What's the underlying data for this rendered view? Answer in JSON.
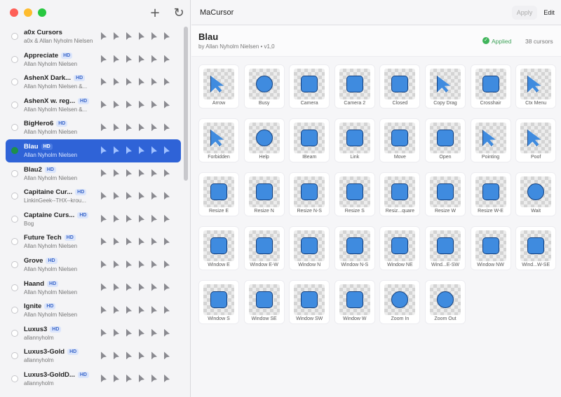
{
  "app": {
    "name": "MaCursor",
    "apply": "Apply",
    "edit": "Edit"
  },
  "sidebar": {
    "add_icon": "+",
    "refresh_icon": "↻",
    "items": [
      {
        "name": "a0x Cursors",
        "author": "a0x & Allan Nyholm Nielsen",
        "hd": "",
        "selected": false
      },
      {
        "name": "Appreciate",
        "author": "Allan Nyholm Nielsen",
        "hd": "HD",
        "selected": false
      },
      {
        "name": "AshenX Dark...",
        "author": "Allan Nyholm Nielsen &...",
        "hd": "HD",
        "selected": false
      },
      {
        "name": "AshenX w. reg...",
        "author": "Allan Nyholm Nielsen &...",
        "hd": "HD",
        "selected": false
      },
      {
        "name": "BigHero6",
        "author": "Allan Nyholm Nielsen",
        "hd": "HD",
        "selected": false
      },
      {
        "name": "Blau",
        "author": "Allan Nyholm Nielsen",
        "hd": "HD",
        "selected": true
      },
      {
        "name": "Blau2",
        "author": "Allan Nyholm Nielsen",
        "hd": "HD",
        "selected": false
      },
      {
        "name": "Capitaine Cur...",
        "author": "LinkinGeek--THX--krou...",
        "hd": "HD",
        "selected": false
      },
      {
        "name": "Captaine Curs...",
        "author": "Bog",
        "hd": "HD",
        "selected": false
      },
      {
        "name": "Future Tech",
        "author": "Allan Nyholm Nielsen",
        "hd": "HD",
        "selected": false
      },
      {
        "name": "Grove",
        "author": "Allan Nyholm Nielsen",
        "hd": "HD",
        "selected": false
      },
      {
        "name": "Haand",
        "author": "Allan Nyholm Nielsen",
        "hd": "HD",
        "selected": false
      },
      {
        "name": "Ignite",
        "author": "Allan Nyholm Nielsen",
        "hd": "HD",
        "selected": false
      },
      {
        "name": "Luxus3",
        "author": "allannyholm",
        "hd": "HD",
        "selected": false
      },
      {
        "name": "Luxus3-Gold",
        "author": "allannyholm",
        "hd": "HD",
        "selected": false
      },
      {
        "name": "Luxus3-GoldD...",
        "author": "allannyholm",
        "hd": "HD",
        "selected": false
      }
    ]
  },
  "theme": {
    "title": "Blau",
    "subtitle": "by Allan Nyholm Nielsen • v1,0",
    "status": "Applied",
    "count": "38 cursors"
  },
  "cursors": [
    {
      "label": "Arrow",
      "shape": "arrow"
    },
    {
      "label": "Busy",
      "shape": "round"
    },
    {
      "label": "Camera",
      "shape": "box"
    },
    {
      "label": "Camera 2",
      "shape": "box"
    },
    {
      "label": "Closed",
      "shape": "box"
    },
    {
      "label": "Copy Drag",
      "shape": "arrow"
    },
    {
      "label": "Crosshair",
      "shape": "box"
    },
    {
      "label": "Ctx Menu",
      "shape": "arrow"
    },
    {
      "label": "Forbidden",
      "shape": "arrow"
    },
    {
      "label": "Help",
      "shape": "round"
    },
    {
      "label": "IBeam",
      "shape": "box"
    },
    {
      "label": "Link",
      "shape": "box"
    },
    {
      "label": "Move",
      "shape": "box"
    },
    {
      "label": "Open",
      "shape": "box"
    },
    {
      "label": "Pointing",
      "shape": "arrow"
    },
    {
      "label": "Poof",
      "shape": "arrow"
    },
    {
      "label": "Resize E",
      "shape": "box"
    },
    {
      "label": "Resize N",
      "shape": "box"
    },
    {
      "label": "Resize N-S",
      "shape": "box"
    },
    {
      "label": "Resize S",
      "shape": "box"
    },
    {
      "label": "Resiz...quare",
      "shape": "box"
    },
    {
      "label": "Resize W",
      "shape": "box"
    },
    {
      "label": "Resize W-E",
      "shape": "box"
    },
    {
      "label": "Wait",
      "shape": "round"
    },
    {
      "label": "Window E",
      "shape": "box"
    },
    {
      "label": "Window E-W",
      "shape": "box"
    },
    {
      "label": "Window N",
      "shape": "box"
    },
    {
      "label": "Window N-S",
      "shape": "box"
    },
    {
      "label": "Window NE",
      "shape": "box"
    },
    {
      "label": "Wind...E-SW",
      "shape": "box"
    },
    {
      "label": "Window NW",
      "shape": "box"
    },
    {
      "label": "Wind...W-SE",
      "shape": "box"
    },
    {
      "label": "Window S",
      "shape": "box"
    },
    {
      "label": "Window SE",
      "shape": "box"
    },
    {
      "label": "Window SW",
      "shape": "box"
    },
    {
      "label": "Window W",
      "shape": "box"
    },
    {
      "label": "Zoom In",
      "shape": "round"
    },
    {
      "label": "Zoom Out",
      "shape": "round"
    }
  ]
}
